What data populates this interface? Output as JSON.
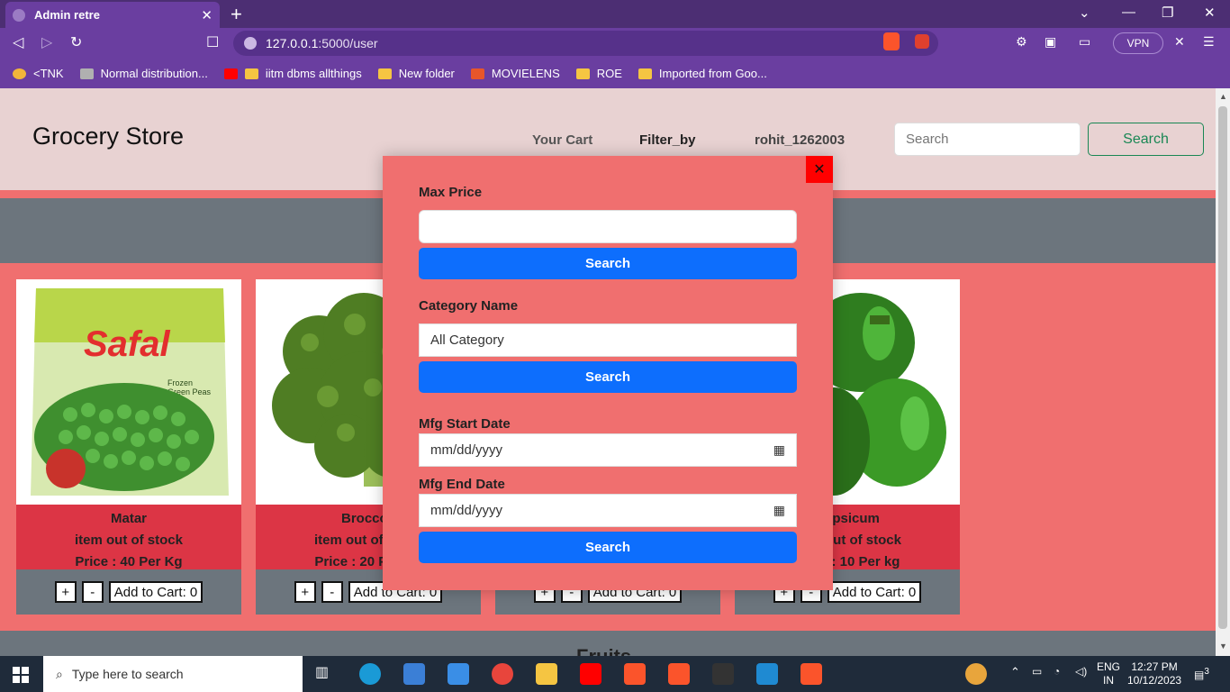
{
  "browser": {
    "tab_title": "Admin retre",
    "url_host": "127.0.0.1",
    "url_path": ":5000/user",
    "vpn_label": "VPN",
    "bookmarks": [
      "<TNK",
      "Normal distribution...",
      "iitm dbms allthings",
      "New folder",
      "MOVIELENS",
      "ROE",
      "Imported from Goo..."
    ]
  },
  "navbar": {
    "brand": "Grocery Store",
    "links": [
      "Your Cart",
      "Filter_by",
      "rohit_1262003"
    ],
    "search_placeholder": "Search",
    "search_button": "Search"
  },
  "section_header": "Fruits",
  "products": [
    {
      "name": "Matar",
      "status": "item out of stock",
      "price": "Price : 40 Per Kg",
      "plus": "+",
      "minus": "-",
      "cart": "Add to Cart: 0"
    },
    {
      "name": "Broccoli",
      "status": "item out of stock",
      "price": "Price : 20 Per Kg",
      "plus": "+",
      "minus": "-",
      "cart": "Add to Cart: 0"
    },
    {
      "name": "",
      "status": "",
      "price": "",
      "plus": "+",
      "minus": "-",
      "cart": "Add to Cart: 0"
    },
    {
      "name": "Capsicum",
      "status": "item out of stock",
      "price": "Price : 10 Per kg",
      "plus": "+",
      "minus": "-",
      "cart": "Add to Cart: 0"
    }
  ],
  "filter_modal": {
    "close_label": "✕",
    "max_price_label": "Max Price",
    "max_price_value": "",
    "search_button": "Search",
    "category_label": "Category Name",
    "category_selected": "All Category",
    "mfg_start_label": "Mfg Start Date",
    "mfg_end_label": "Mfg End Date",
    "date_placeholder": "mm/dd/yyyy"
  },
  "taskbar": {
    "search_placeholder": "Type here to search",
    "lang_top": "ENG",
    "lang_bottom": "IN",
    "time": "12:27 PM",
    "date": "10/12/2023",
    "notif_count": "3"
  },
  "colors": {
    "page_bg": "#f06f6f",
    "navbar_bg": "#e8d2d2",
    "band": "#6c757d",
    "card_info": "#dc3545",
    "primary": "#0d6efd",
    "close": "#ff0000",
    "browser": "#6a3ea0"
  }
}
